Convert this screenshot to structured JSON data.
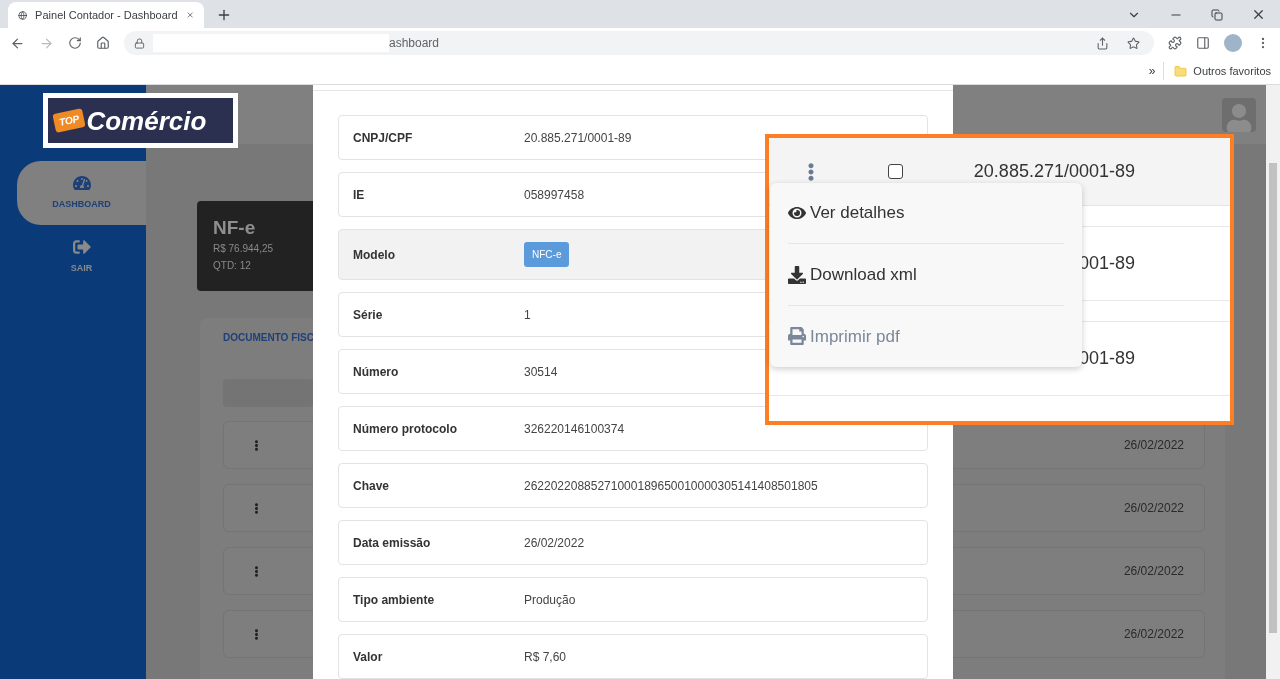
{
  "browser": {
    "tab_title": "Painel Contador - Dashboard",
    "address": "ashboard",
    "bookmarks_overflow": "»",
    "bookmark_folder": "Outros favoritos"
  },
  "sidebar": {
    "logo": {
      "tag": "TOP",
      "word": "Comércio"
    },
    "items": [
      {
        "label": "DASHBOARD",
        "kind": "gauge",
        "selected": true
      },
      {
        "label": "SAIR",
        "kind": "exit",
        "selected": false
      }
    ]
  },
  "summary_card": {
    "title": "NF-e",
    "amount": "R$ 76.944,25",
    "count": "QTD: 12"
  },
  "panel": {
    "tab_label": "DOCUMENTO FISC",
    "rows": [
      {
        "date": "26/02/2022"
      },
      {
        "date": "26/02/2022"
      },
      {
        "date": "26/02/2022"
      },
      {
        "date": "26/02/2022"
      }
    ]
  },
  "modal": {
    "fields": [
      {
        "label": "CNPJ/CPF",
        "value": "20.885.271/0001-89",
        "kind": "text"
      },
      {
        "label": "IE",
        "value": "058997458",
        "kind": "text"
      },
      {
        "label": "Modelo",
        "value": "NFC-e",
        "kind": "badge"
      },
      {
        "label": "Série",
        "value": "1",
        "kind": "text"
      },
      {
        "label": "Número",
        "value": "30514",
        "kind": "text"
      },
      {
        "label": "Número protocolo",
        "value": "326220146100374",
        "kind": "text"
      },
      {
        "label": "Chave",
        "value": "26220220885271000189650010000305141408501805",
        "kind": "text"
      },
      {
        "label": "Data emissão",
        "value": "26/02/2022",
        "kind": "text"
      },
      {
        "label": "Tipo ambiente",
        "value": "Produção",
        "kind": "text"
      },
      {
        "label": "Valor",
        "value": "R$ 7,60",
        "kind": "text"
      }
    ]
  },
  "callout": {
    "rows": [
      {
        "cnpj": "20.885.271/0001-89",
        "checked": false
      },
      {
        "cnpj": "001-89"
      },
      {
        "cnpj": "001-89"
      }
    ],
    "menu": [
      {
        "label": "Ver detalhes",
        "kind": "view",
        "disabled": false
      },
      {
        "label": "Download xml",
        "kind": "download",
        "disabled": false
      },
      {
        "label": "Imprimir pdf",
        "kind": "print",
        "disabled": true
      }
    ]
  }
}
